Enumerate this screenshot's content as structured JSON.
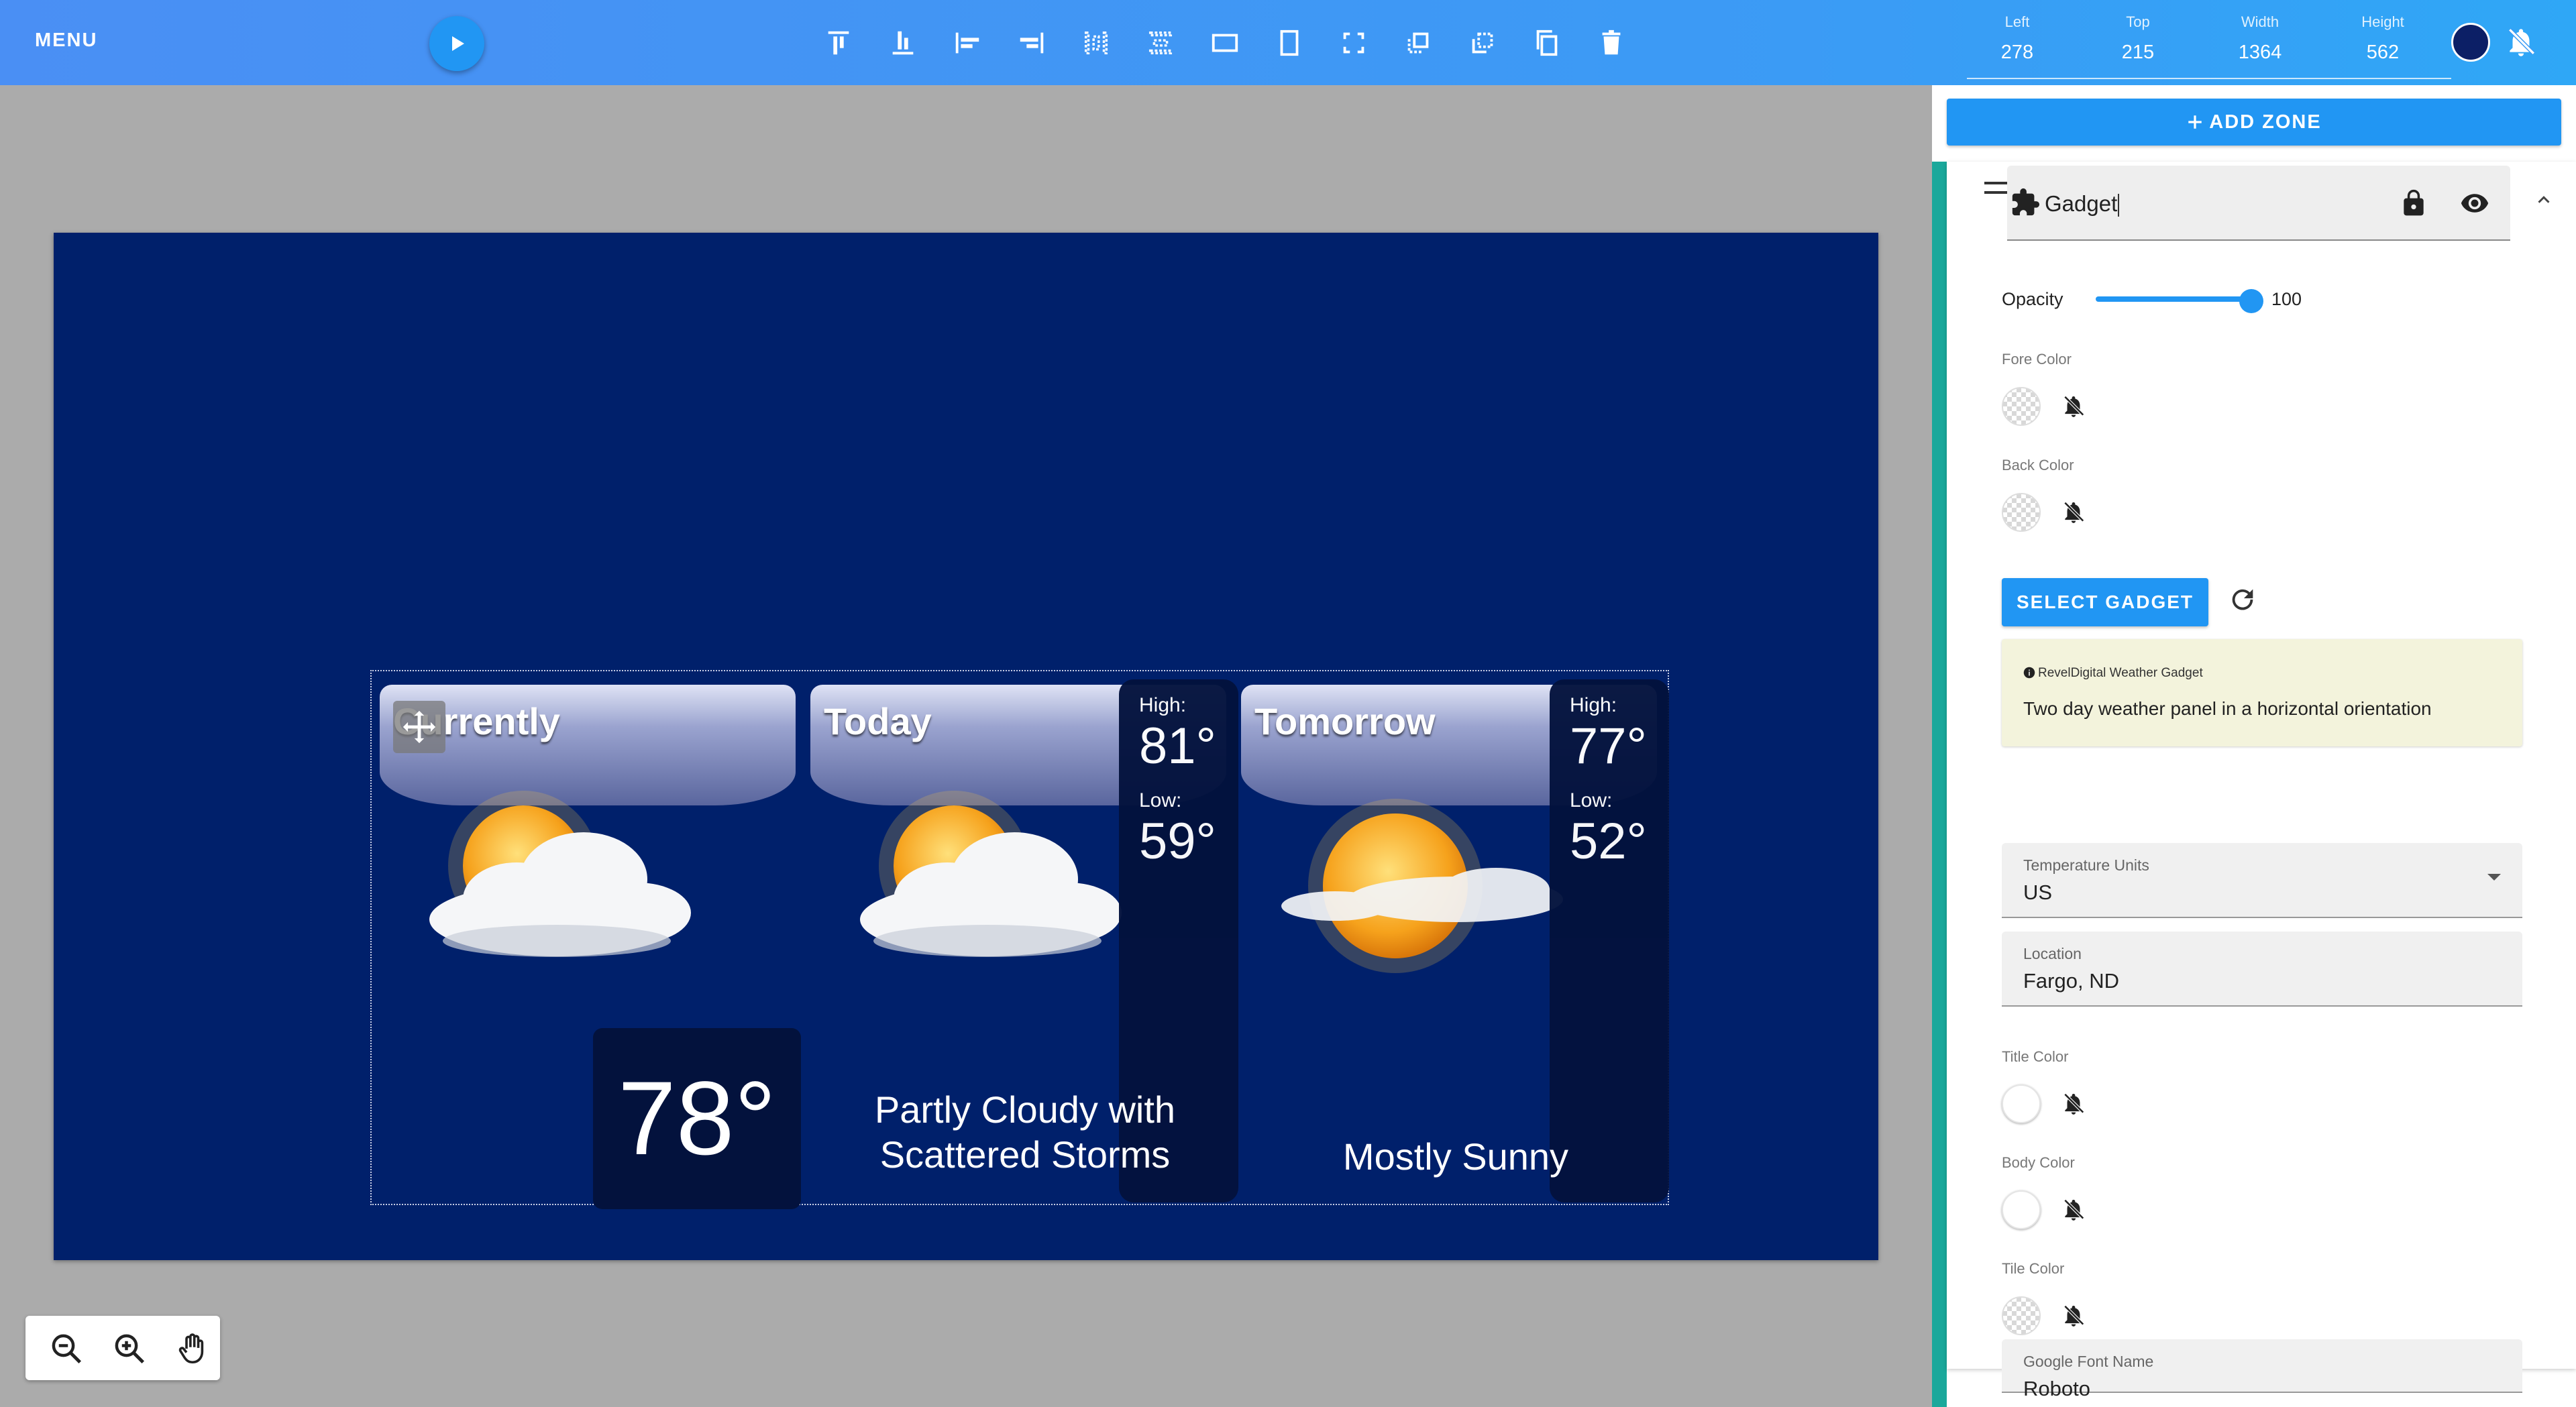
{
  "toolbar": {
    "menu_label": "MENU",
    "play_icon": "play-icon",
    "tools": [
      "align-top-icon",
      "align-bottom-icon",
      "align-left-icon",
      "align-right-icon",
      "distribute-horizontal-icon",
      "distribute-vertical-icon",
      "stretch-width-icon",
      "stretch-height-icon",
      "fullscreen-icon",
      "bring-forward-icon",
      "send-backward-icon",
      "duplicate-icon",
      "delete-icon"
    ],
    "fields": {
      "left_label": "Left",
      "left_value": "278",
      "top_label": "Top",
      "top_value": "215",
      "width_label": "Width",
      "width_value": "1364",
      "height_label": "Height",
      "height_value": "562"
    },
    "bg_color": "#0c1f66"
  },
  "canvas": {
    "background": "#00206b",
    "weather": {
      "currently": {
        "title": "Currently",
        "temp": "78°"
      },
      "today": {
        "title": "Today",
        "high_label": "High:",
        "high": "81°",
        "low_label": "Low:",
        "low": "59°",
        "condition_line1": "Partly Cloudy with",
        "condition_line2": "Scattered Storms"
      },
      "tomorrow": {
        "title": "Tomorrow",
        "high_label": "High:",
        "high": "77°",
        "low_label": "Low:",
        "low": "52°",
        "condition": "Mostly Sunny"
      }
    }
  },
  "zoom_tools": [
    "zoom-out-icon",
    "zoom-in-icon",
    "pan-hand-icon"
  ],
  "panel": {
    "add_zone_label": "ADD ZONE",
    "zone_name": "Gadget",
    "opacity_label": "Opacity",
    "opacity_value": "100",
    "opacity_level": 1.0,
    "fore_color_label": "Fore Color",
    "back_color_label": "Back Color",
    "select_gadget_label": "SELECT GADGET",
    "info_title": "RevelDigital Weather Gadget",
    "info_desc": "Two day weather panel in a horizontal orientation",
    "temp_units_label": "Temperature Units",
    "temp_units_value": "US",
    "location_label": "Location",
    "location_value": "Fargo, ND",
    "title_color_label": "Title Color",
    "body_color_label": "Body Color",
    "tile_color_label": "Tile Color",
    "font_label": "Google Font Name",
    "font_value": "Roboto"
  }
}
